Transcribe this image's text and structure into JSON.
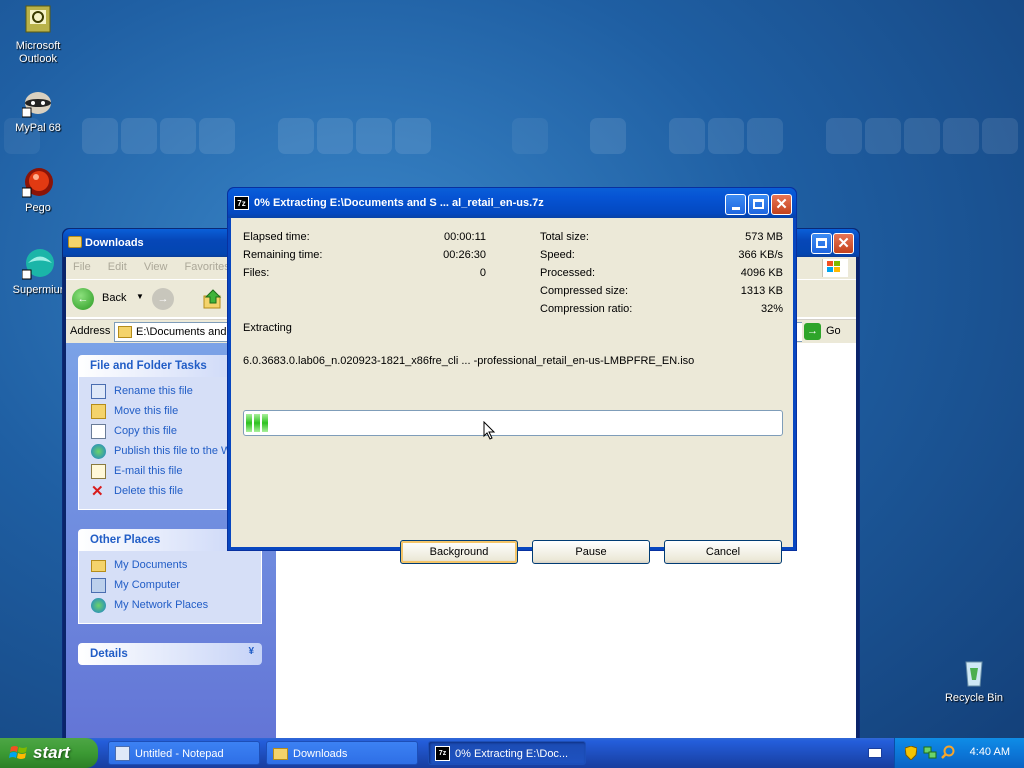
{
  "desktop": {
    "icons": [
      {
        "name": "microsoft-outlook",
        "label_line1": "Microsoft",
        "label_line2": "Outlook"
      },
      {
        "name": "mypal",
        "label_line1": "MyPal 68",
        "label_line2": ""
      },
      {
        "name": "pego",
        "label_line1": "Pego",
        "label_line2": ""
      },
      {
        "name": "supermium",
        "label_line1": "Supermiur",
        "label_line2": ""
      },
      {
        "name": "recycle-bin",
        "label_line1": "Recycle Bin",
        "label_line2": ""
      }
    ]
  },
  "explorer": {
    "title": "Downloads",
    "menu": [
      "File",
      "Edit",
      "View",
      "Favorites"
    ],
    "back_label": "Back",
    "address_label": "Address",
    "address_value": "E:\\Documents and",
    "go_label": "Go",
    "file_tasks": {
      "title": "File and Folder Tasks",
      "items": [
        "Rename this file",
        "Move this file",
        "Copy this file",
        "Publish this file to the W",
        "E-mail this file",
        "Delete this file"
      ]
    },
    "other_places": {
      "title": "Other Places",
      "items": [
        "My Documents",
        "My Computer",
        "My Network Places"
      ]
    },
    "details": {
      "title": "Details"
    }
  },
  "dialog": {
    "title": "0% Extracting E:\\Documents and S ... al_retail_en-us.7z",
    "app_icon_text": "7z",
    "left_stats": [
      {
        "label": "Elapsed time:",
        "value": "00:00:11"
      },
      {
        "label": "Remaining time:",
        "value": "00:26:30"
      },
      {
        "label": "Files:",
        "value": "0"
      }
    ],
    "right_stats": [
      {
        "label": "Total size:",
        "value": "573 MB"
      },
      {
        "label": "Speed:",
        "value": "366 KB/s"
      },
      {
        "label": "Processed:",
        "value": "4096 KB"
      },
      {
        "label": "Compressed size:",
        "value": "1313 KB"
      },
      {
        "label": "Compression ratio:",
        "value": "32%"
      }
    ],
    "status_label": "Extracting",
    "current_file": "6.0.3683.0.lab06_n.020923-1821_x86fre_cli ... -professional_retail_en-us-LMBPFRE_EN.iso",
    "progress_percent": 0,
    "buttons": {
      "background": "Background",
      "pause": "Pause",
      "cancel": "Cancel"
    }
  },
  "taskbar": {
    "start_label": "start",
    "tasks": [
      {
        "label": "Untitled - Notepad",
        "active": false
      },
      {
        "label": "Downloads",
        "active": false
      },
      {
        "label": "0% Extracting E:\\Doc...",
        "active": true
      }
    ],
    "clock": "4:40 AM"
  },
  "colors": {
    "xp_blue": "#0a5fd8",
    "taskpane_link": "#215dc6",
    "progress_green": "#2dc21f",
    "start_green": "#3c9a34"
  }
}
